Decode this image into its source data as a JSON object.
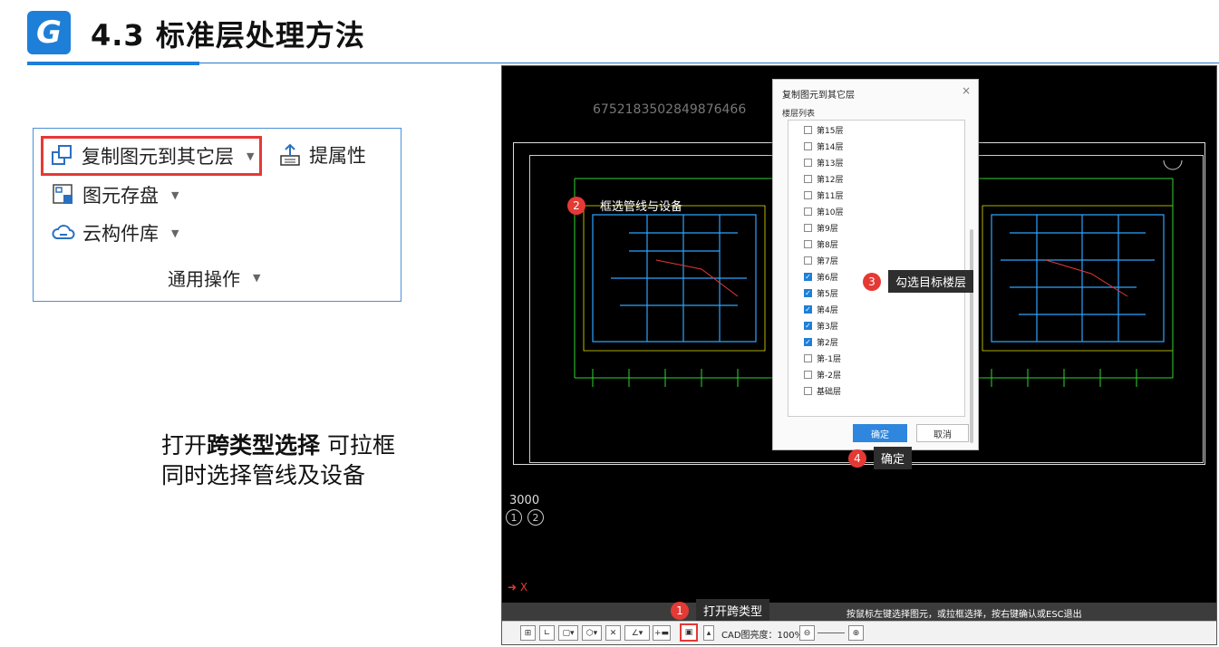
{
  "header": {
    "logo_letter": "G",
    "title": "4.3 标准层处理方法"
  },
  "ribbon": {
    "copy_label": "复制图元到其它层",
    "extract_label": "提属性",
    "save_label": "图元存盘",
    "cloud_label": "云构件库",
    "group_label": "通用操作"
  },
  "description": {
    "line1_prefix": "打开",
    "line1_bold": "跨类型选择",
    "line1_suffix": " 可拉框",
    "line2": "同时选择管线及设备"
  },
  "cad": {
    "watermark": "6752183502849876466",
    "dim_value": "3000",
    "axis_1": "1",
    "axis_2": "2",
    "axis_x": "X",
    "status_text": "按鼠标左键选择图元，或拉框选择，按右键确认或ESC退出",
    "cad_brightness": "CAD图亮度：100%",
    "callouts": [
      {
        "num": "1",
        "text": "打开跨类型"
      },
      {
        "num": "2",
        "text": "框选管线与设备"
      },
      {
        "num": "3",
        "text": "勾选目标楼层"
      },
      {
        "num": "4",
        "text": "确定"
      }
    ]
  },
  "dialog": {
    "title": "复制图元到其它层",
    "close": "×",
    "group": "楼层列表",
    "floors": [
      {
        "label": "第15层",
        "checked": false
      },
      {
        "label": "第14层",
        "checked": false
      },
      {
        "label": "第13层",
        "checked": false
      },
      {
        "label": "第12层",
        "checked": false
      },
      {
        "label": "第11层",
        "checked": false
      },
      {
        "label": "第10层",
        "checked": false
      },
      {
        "label": "第9层",
        "checked": false
      },
      {
        "label": "第8层",
        "checked": false
      },
      {
        "label": "第7层",
        "checked": false
      },
      {
        "label": "第6层",
        "checked": true
      },
      {
        "label": "第5层",
        "checked": true
      },
      {
        "label": "第4层",
        "checked": true
      },
      {
        "label": "第3层",
        "checked": true
      },
      {
        "label": "第2层",
        "checked": true
      },
      {
        "label": "第-1层",
        "checked": false
      },
      {
        "label": "第-2层",
        "checked": false
      },
      {
        "label": "基础层",
        "checked": false
      }
    ],
    "ok_label": "确定",
    "cancel_label": "取消"
  },
  "colors": {
    "accent": "#1e7fd8",
    "highlight": "#e53935",
    "cad_bg": "#000000"
  }
}
